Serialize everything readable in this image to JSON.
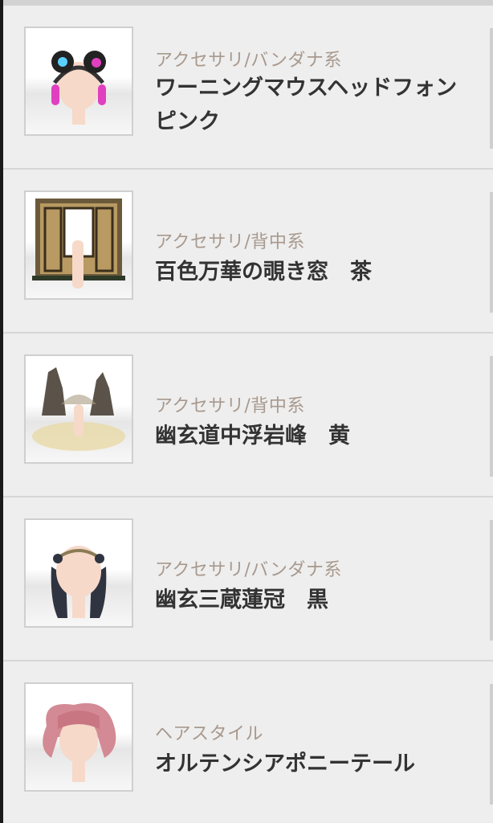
{
  "items": [
    {
      "category": "アクセサリ/バンダナ系",
      "name": "ワーニングマウスヘッドフォン　ピンク",
      "thumbnail_icon": "headphones-icon"
    },
    {
      "category": "アクセサリ/背中系",
      "name": "百色万華の覗き窓　茶",
      "thumbnail_icon": "window-screen-icon"
    },
    {
      "category": "アクセサリ/背中系",
      "name": "幽玄道中浮岩峰　黄",
      "thumbnail_icon": "rock-peaks-icon"
    },
    {
      "category": "アクセサリ/バンダナ系",
      "name": "幽玄三蔵蓮冠　黒",
      "thumbnail_icon": "lotus-crown-icon"
    },
    {
      "category": "ヘアスタイル",
      "name": "オルテンシアポニーテール",
      "thumbnail_icon": "ponytail-hair-icon"
    }
  ],
  "colors": {
    "category_text": "#a8998e",
    "name_text": "#333333",
    "background": "#eeeeee"
  }
}
